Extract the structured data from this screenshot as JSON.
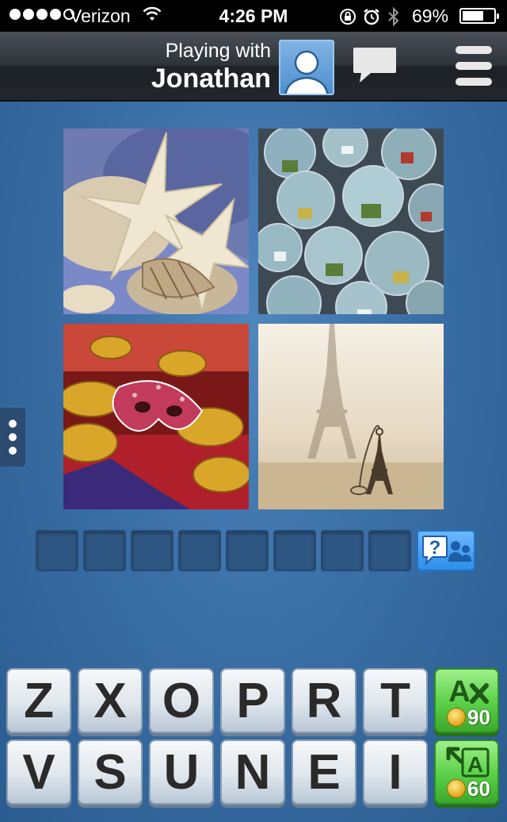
{
  "status_bar": {
    "carrier": "Verizon",
    "time": "4:26 PM",
    "battery": "69%",
    "battery_level": 0.69,
    "signal_bars": 4
  },
  "header": {
    "playing_with": "Playing with",
    "opponent": "Jonathan"
  },
  "puzzle": {
    "photos": [
      "starfish-and-seashells",
      "snow-globes",
      "carnival-masks",
      "eiffel-tower-keychain"
    ],
    "answer_length": 8,
    "answer_letters": [
      "",
      "",
      "",
      "",
      "",
      "",
      "",
      ""
    ]
  },
  "letters": {
    "row1": [
      "Z",
      "X",
      "O",
      "P",
      "R",
      "T"
    ],
    "row2": [
      "V",
      "S",
      "U",
      "N",
      "E",
      "I"
    ]
  },
  "powerups": {
    "remove": {
      "cost": "90",
      "icon": "remove-letter-icon"
    },
    "reveal": {
      "cost": "60",
      "icon": "reveal-letter-icon"
    }
  },
  "colors": {
    "background": "#3a6fa5",
    "powerup_green": "#59cf47",
    "ask_blue": "#2d8ee8"
  }
}
